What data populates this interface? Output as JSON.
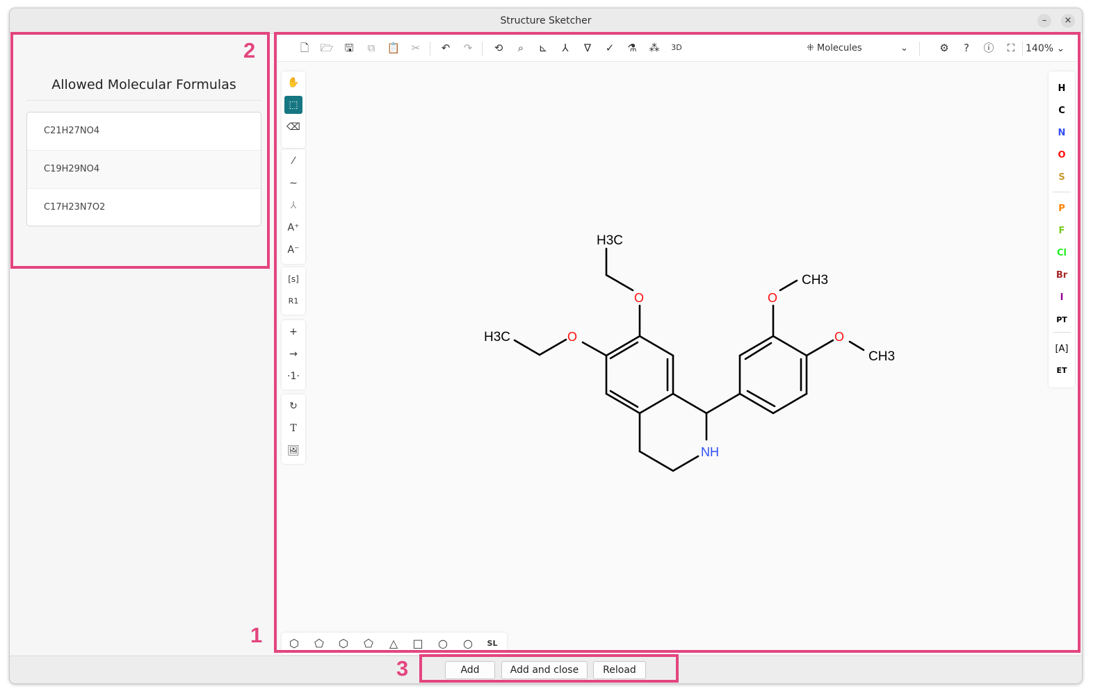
{
  "window": {
    "title": "Structure Sketcher",
    "minimize_label": "–",
    "close_label": "×"
  },
  "left_panel": {
    "title": "Allowed Molecular Formulas",
    "formulas": [
      "C21H27NO4",
      "C19H29NO4",
      "C17H23N7O2"
    ]
  },
  "top_toolbar": {
    "icons": [
      "new-file-icon",
      "open-icon",
      "save-icon",
      "copy-icon",
      "paste-icon",
      "cut-icon",
      "undo-icon",
      "redo-icon",
      "layout-icon",
      "clean-icon",
      "aromatize-icon",
      "calculate-cip-icon",
      "stereo-icon",
      "check-icon",
      "analyse-icon",
      "explicit-hydrogens-icon",
      "3d-view-icon",
      "molecules-mode-icon",
      "settings-icon",
      "help-icon",
      "about-icon",
      "fullscreen-icon"
    ],
    "mode_label": "Molecules",
    "zoom_label": "140%"
  },
  "left_toolbar": {
    "icons": [
      "hand-icon",
      "select-rectangle-icon",
      "eraser-icon",
      "single-bond-icon",
      "chain-icon",
      "stereo-label-icon",
      "charge-plus-icon",
      "charge-minus-icon",
      "s-group-icon",
      "r-group-icon",
      "plus-icon",
      "reaction-arrow-icon",
      "reaction-mapping-icon",
      "rotate-icon",
      "text-icon",
      "add-image-icon"
    ],
    "active": "select-rectangle-icon",
    "sgroup_label": "[s]",
    "rgroup_label": "R1"
  },
  "atoms": [
    {
      "symbol": "H",
      "color": "#000000"
    },
    {
      "symbol": "C",
      "color": "#000000"
    },
    {
      "symbol": "N",
      "color": "#304ff7"
    },
    {
      "symbol": "O",
      "color": "#ff0d0d"
    },
    {
      "symbol": "S",
      "color": "#c99a2e"
    },
    {
      "symbol": "P",
      "color": "#ff8000"
    },
    {
      "symbol": "F",
      "color": "#78cc1e"
    },
    {
      "symbol": "Cl",
      "color": "#1ff01f"
    },
    {
      "symbol": "Br",
      "color": "#a62929"
    },
    {
      "symbol": "I",
      "color": "#940094"
    }
  ],
  "right_toolbar_extra": {
    "periodic_table_label": "PT",
    "extended_table_label": "ET",
    "periodic_table_icon": "periodic-table-icon",
    "any_atom_icon": "any-atom-icon"
  },
  "bottom_shapes": {
    "icons": [
      "benzene-icon",
      "cyclopentadiene-icon",
      "cyclohexane-icon",
      "cyclopentane-icon",
      "cyclopropane-icon",
      "cyclobutane-icon",
      "cycloheptane-icon",
      "cyclooctane-icon",
      "structure-library-icon"
    ],
    "library_label": "SL"
  },
  "molecule": {
    "labels": {
      "methyl_top": "H3C",
      "methyl_left": "H3C",
      "methyl_right_top": "CH3",
      "methyl_right": "CH3",
      "oxygen": "O",
      "amine": "NH"
    },
    "colors": {
      "bond": "#000000",
      "oxygen": "#ff0d0d",
      "nitrogen": "#304ff7"
    }
  },
  "dialog_buttons": {
    "add": "Add",
    "add_close": "Add and close",
    "reload": "Reload"
  },
  "callouts": {
    "editor": "1",
    "formulas": "2",
    "buttons": "3"
  },
  "colors": {
    "accent": "#167782",
    "callout": "#e3457f"
  }
}
